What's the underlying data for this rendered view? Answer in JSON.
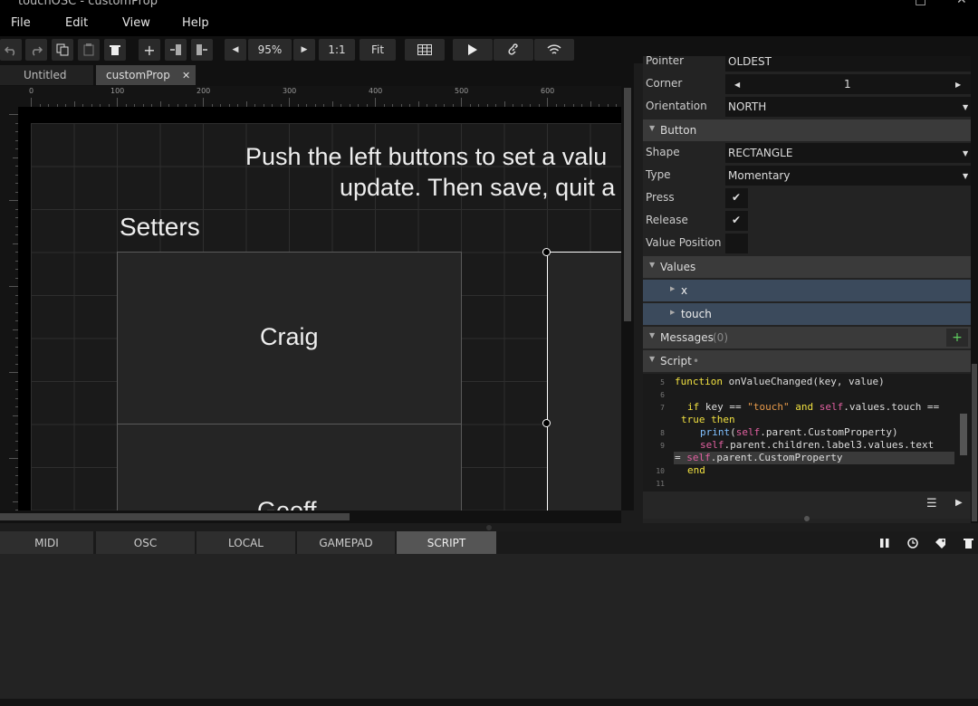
{
  "window": {
    "title": "touchOSC - customProp"
  },
  "menu": [
    "File",
    "Edit",
    "View",
    "Help"
  ],
  "toolbar": {
    "zoom": "95%",
    "one_to_one": "1:1",
    "fit": "Fit"
  },
  "tabs": [
    {
      "label": "Untitled"
    },
    {
      "label": "customProp",
      "close": "✕"
    }
  ],
  "ruler": {
    "labels": [
      "0",
      "100",
      "200",
      "300",
      "400",
      "500",
      "600"
    ]
  },
  "canvas": {
    "heading_line1": "Push the left buttons to set a valu",
    "heading_line2": "update. Then save, quit a",
    "setters": "Setters",
    "button1": "Craig",
    "button2": "Geoff"
  },
  "inspector": {
    "pointer_label": "Pointer",
    "pointer_value": "OLDEST",
    "corner_label": "Corner",
    "corner_value": "1",
    "orientation_label": "Orientation",
    "orientation_value": "NORTH",
    "button_section": "Button",
    "shape_label": "Shape",
    "shape_value": "RECTANGLE",
    "type_label": "Type",
    "type_value": "Momentary",
    "press_label": "Press",
    "release_label": "Release",
    "value_position_label": "Value Position",
    "values_section": "Values",
    "value_items": [
      "x",
      "touch"
    ],
    "messages_section": "Messages",
    "messages_count": "(0)",
    "script_section": "Script"
  },
  "script_lines": [
    {
      "n": "5"
    },
    {
      "n": "6"
    },
    {
      "n": "7"
    },
    {
      "n": "8"
    },
    {
      "n": "9"
    },
    {
      "n": "10"
    },
    {
      "n": "11"
    }
  ],
  "bottom_tabs": [
    "MIDI",
    "OSC",
    "LOCAL",
    "GAMEPAD",
    "SCRIPT"
  ],
  "colors": {
    "accent_selection": "#3b4a5c",
    "active_tab": "#555555",
    "add_green": "#60d060"
  },
  "icons": [
    "undo-icon",
    "redo-icon",
    "copy-icon",
    "paste-icon",
    "delete-icon",
    "add-icon",
    "play-icon",
    "link-icon",
    "wifi-icon",
    "grid-icon",
    "pause-icon",
    "clock-icon",
    "tag-icon",
    "trash-icon"
  ]
}
